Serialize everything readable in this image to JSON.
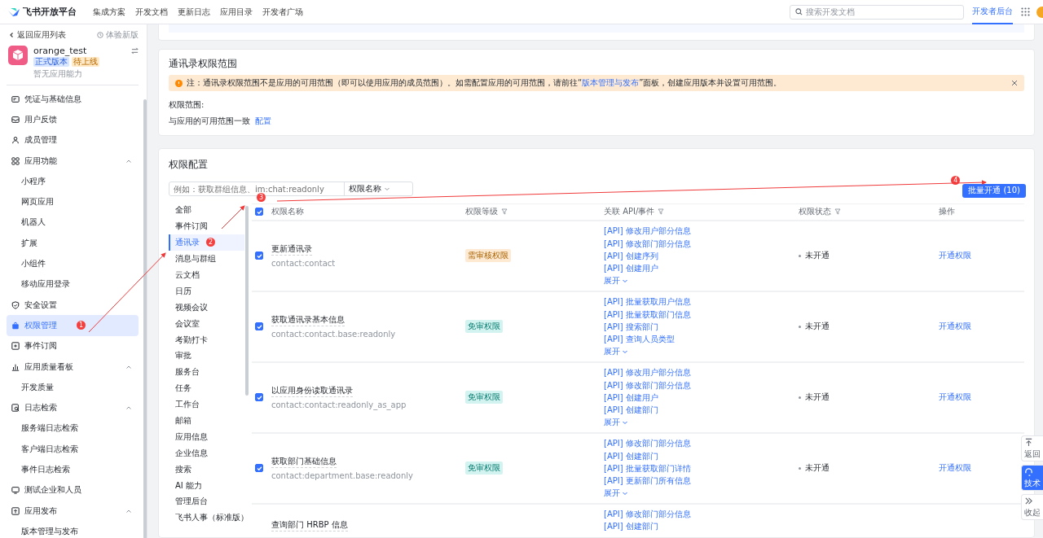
{
  "topbar": {
    "brand": "飞书开放平台",
    "nav": [
      "集成方案",
      "开发文档",
      "更新日志",
      "应用目录",
      "开发者广场"
    ],
    "search": {
      "placeholder": "搜索开发文档"
    },
    "tabs": [
      {
        "label": "开发者后台",
        "selected": true
      }
    ]
  },
  "sidebar": {
    "back": "返回应用列表",
    "new_version": "体验新版",
    "app": {
      "name": "orange_test",
      "tags": [
        {
          "label": "正式版本",
          "kind": "info"
        },
        {
          "label": "待上线",
          "kind": "warn"
        }
      ],
      "subtitle": "暂无应用能力"
    },
    "items": [
      {
        "label": "凭证与基础信息",
        "selected": false
      },
      {
        "label": "用户反馈",
        "selected": false
      },
      {
        "label": "成员管理",
        "selected": false
      },
      {
        "label": "应用功能",
        "selected": false,
        "expanded": true,
        "children": [
          {
            "label": "小程序",
            "selected": false
          },
          {
            "label": "网页应用",
            "selected": false
          },
          {
            "label": "机器人",
            "selected": false
          },
          {
            "label": "扩展",
            "selected": false
          },
          {
            "label": "小组件",
            "selected": false
          },
          {
            "label": "移动应用登录",
            "selected": false
          }
        ]
      },
      {
        "label": "安全设置",
        "selected": false
      },
      {
        "label": "权限管理",
        "selected": true
      },
      {
        "label": "事件订阅",
        "selected": false
      },
      {
        "label": "应用质量看板",
        "selected": false,
        "expanded": true,
        "children": [
          {
            "label": "开发质量",
            "selected": false
          }
        ]
      },
      {
        "label": "日志检索",
        "selected": false,
        "expanded": true,
        "children": [
          {
            "label": "服务端日志检索",
            "selected": false
          },
          {
            "label": "客户端日志检索",
            "selected": false
          },
          {
            "label": "事件日志检索",
            "selected": false
          }
        ]
      },
      {
        "label": "测试企业和人员",
        "selected": false
      },
      {
        "label": "应用发布",
        "selected": false,
        "expanded": true,
        "children": [
          {
            "label": "版本管理与发布",
            "selected": false
          }
        ]
      }
    ]
  },
  "scope_section": {
    "title": "通讯录权限范围",
    "notice": {
      "before": "注：通讯录权限范围不是应用的可用范围（即可以使用应用的成员范围）。如需配置应用的可用范围，请前往“",
      "link": "版本管理与发布",
      "after": "”面板，创建应用版本并设置可用范围。"
    },
    "label": "权限范围:",
    "value": "与应用的可用范围一致",
    "action": "配置"
  },
  "permission_section": {
    "title": "权限配置",
    "search": {
      "placeholder": "例如：获取群组信息、im:chat:readonly"
    },
    "filter_select": "权限名称",
    "batch_button": "批量开通 (10)",
    "categories": [
      {
        "label": "全部",
        "selected": false
      },
      {
        "label": "事件订阅",
        "selected": false
      },
      {
        "label": "通讯录",
        "selected": true
      },
      {
        "label": "消息与群组",
        "selected": false
      },
      {
        "label": "云文档",
        "selected": false
      },
      {
        "label": "日历",
        "selected": false
      },
      {
        "label": "视频会议",
        "selected": false
      },
      {
        "label": "会议室",
        "selected": false
      },
      {
        "label": "考勤打卡",
        "selected": false
      },
      {
        "label": "审批",
        "selected": false
      },
      {
        "label": "服务台",
        "selected": false
      },
      {
        "label": "任务",
        "selected": false
      },
      {
        "label": "工作台",
        "selected": false
      },
      {
        "label": "邮箱",
        "selected": false
      },
      {
        "label": "应用信息",
        "selected": false
      },
      {
        "label": "企业信息",
        "selected": false
      },
      {
        "label": "搜索",
        "selected": false
      },
      {
        "label": "AI 能力",
        "selected": false
      },
      {
        "label": "管理后台",
        "selected": false
      },
      {
        "label": "飞书人事（标准版）",
        "selected": false
      }
    ],
    "table": {
      "all_checked": true,
      "columns": [
        {
          "label": "权限名称",
          "filter": false
        },
        {
          "label": "权限等级",
          "filter": true
        },
        {
          "label": "关联 API/事件",
          "filter": true
        },
        {
          "label": "权限状态",
          "filter": true
        },
        {
          "label": "操作",
          "filter": false
        }
      ],
      "rows": [
        {
          "checked": true,
          "name": "更新通讯录",
          "scope": "contact:contact",
          "level": {
            "label": "需审核权限",
            "kind": "review"
          },
          "apis": [
            "[API] 修改用户部分信息",
            "[API] 修改部门部分信息",
            "[API] 创建序列",
            "[API] 创建用户"
          ],
          "expand": "展开",
          "status": "未开通",
          "action": "开通权限"
        },
        {
          "checked": true,
          "name": "获取通讯录基本信息",
          "scope": "contact:contact.base:readonly",
          "level": {
            "label": "免审权限",
            "kind": "free"
          },
          "apis": [
            "[API] 批量获取用户信息",
            "[API] 批量获取部门信息",
            "[API] 搜索部门",
            "[API] 查询人员类型"
          ],
          "expand": "展开",
          "status": "未开通",
          "action": "开通权限"
        },
        {
          "checked": true,
          "name": "以应用身份读取通讯录",
          "scope": "contact:contact:readonly_as_app",
          "level": {
            "label": "免审权限",
            "kind": "free"
          },
          "apis": [
            "[API] 修改用户部分信息",
            "[API] 修改部门部分信息",
            "[API] 创建用户",
            "[API] 创建部门"
          ],
          "expand": "展开",
          "status": "未开通",
          "action": "开通权限"
        },
        {
          "checked": true,
          "name": "获取部门基础信息",
          "scope": "contact:department.base:readonly",
          "level": {
            "label": "免审权限",
            "kind": "free"
          },
          "apis": [
            "[API] 修改部门部分信息",
            "[API] 创建部门",
            "[API] 批量获取部门详情",
            "[API] 更新部门所有信息"
          ],
          "expand": "展开",
          "status": "未开通",
          "action": "开通权限"
        },
        {
          "name": "查询部门 HRBP 信息",
          "apis": [
            "[API] 修改部门部分信息",
            "[API] 创建部门"
          ]
        }
      ]
    }
  },
  "float_buttons": [
    {
      "label": "返回",
      "selected": false
    },
    {
      "label": "技术",
      "selected": true
    },
    {
      "label": "收起",
      "selected": false
    }
  ],
  "annotations": [
    {
      "label": "1"
    },
    {
      "label": "2"
    },
    {
      "label": "3"
    },
    {
      "label": "4"
    }
  ]
}
